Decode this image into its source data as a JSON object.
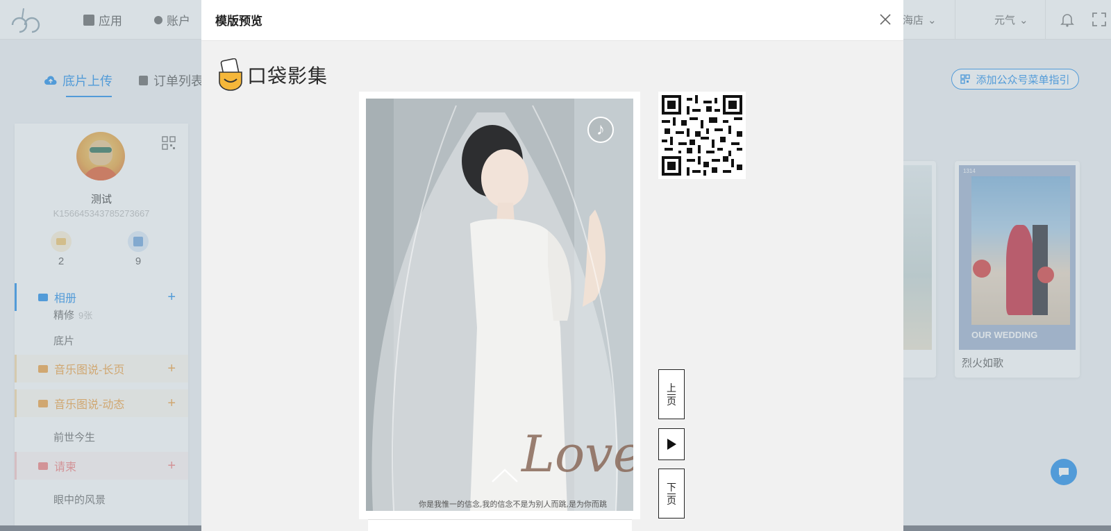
{
  "topbar": {
    "nav_apps": "应用",
    "nav_account": "账户",
    "store": "海店",
    "user": "元气"
  },
  "tabs": {
    "upload": "底片上传",
    "orders": "订单列表",
    "menu_guide": "添加公众号菜单指引"
  },
  "profile": {
    "name": "测试",
    "id": "K156645343785273667",
    "stat_a": "2",
    "stat_b": "9"
  },
  "sidebar": {
    "album": "相册",
    "sub_retouch": "精修",
    "sub_retouch_count": "9张",
    "sub_negative": "底片",
    "music_long": "音乐图说-长页",
    "music_dynamic": "音乐图说-动态",
    "sub_past_life": "前世今生",
    "invitation": "请柬",
    "sub_scenery": "眼中的风景",
    "plus": "+"
  },
  "cards": {
    "card_fire_title": "烈火如歌",
    "card_fire_banner": "OUR WEDDING",
    "card_fire_tag": "1314"
  },
  "modal": {
    "title": "模版预览",
    "brand": "口袋影集",
    "preview_script": "Love",
    "preview_caption": "你是我惟一的信念,我的信念不是为别人而跳,是为你而跳",
    "btn_prev": [
      "上",
      "一",
      "页"
    ],
    "btn_next": [
      "下",
      "一",
      "页"
    ]
  },
  "colors": {
    "accent": "#1f8ceb",
    "orange": "#f0a040",
    "red": "#f47f7f"
  },
  "icons": {
    "close": "close-icon",
    "music": "music-note-icon",
    "play": "play-icon",
    "up_arrow": "chevron-up-icon"
  }
}
